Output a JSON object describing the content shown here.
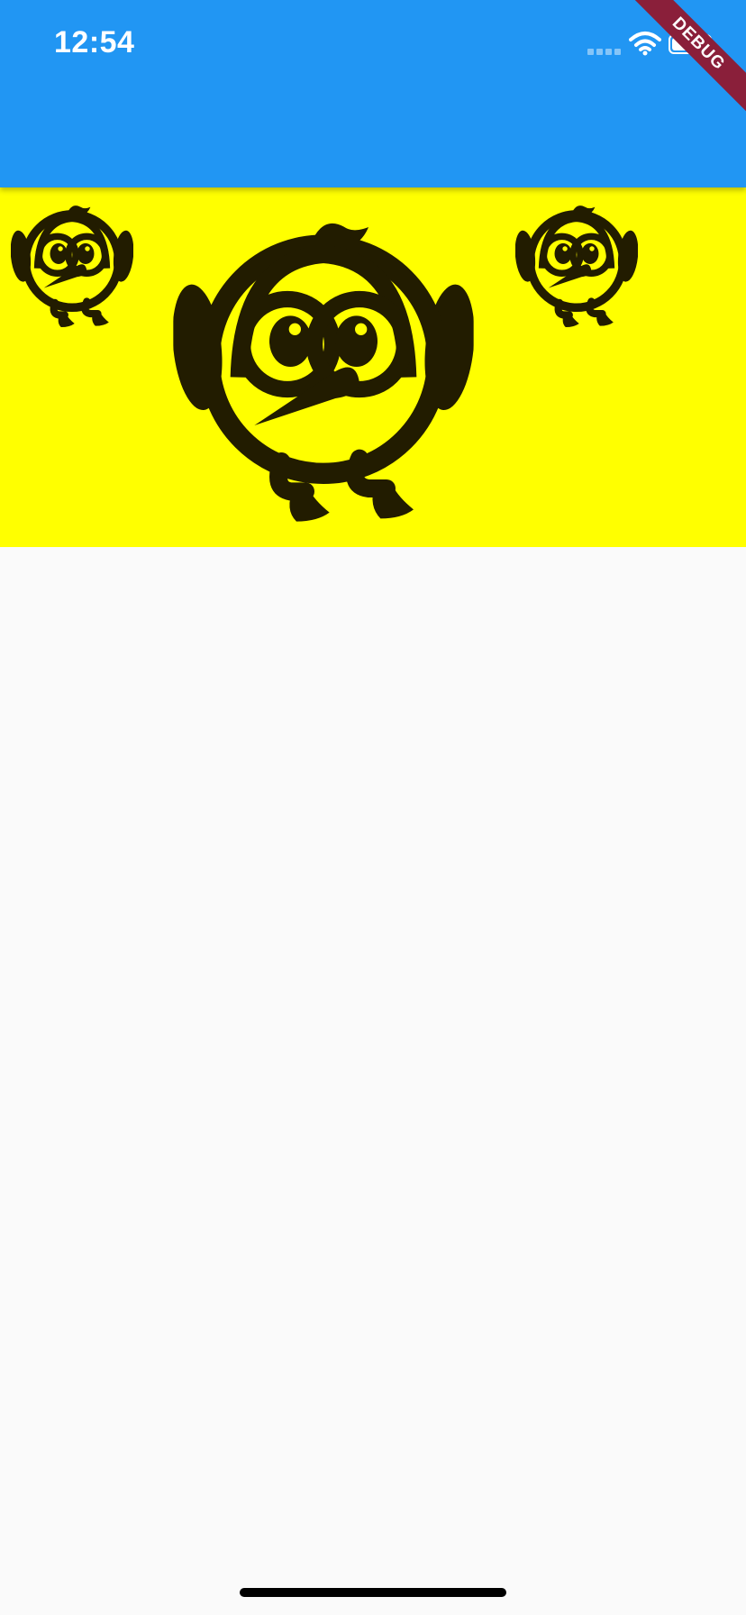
{
  "status_bar": {
    "time": "12:54",
    "wifi_icon": "wifi-icon",
    "battery_icon": "battery-icon",
    "signal_icon": "cellular-signal-icon"
  },
  "debug_banner": {
    "label": "DEBUG"
  },
  "app_bar": {
    "color": "#2196f3"
  },
  "banner": {
    "background": "#ffff00",
    "icon": "bird-mascot-icon",
    "icon_color": "#221c00"
  },
  "page": {
    "background": "#fafafa"
  }
}
